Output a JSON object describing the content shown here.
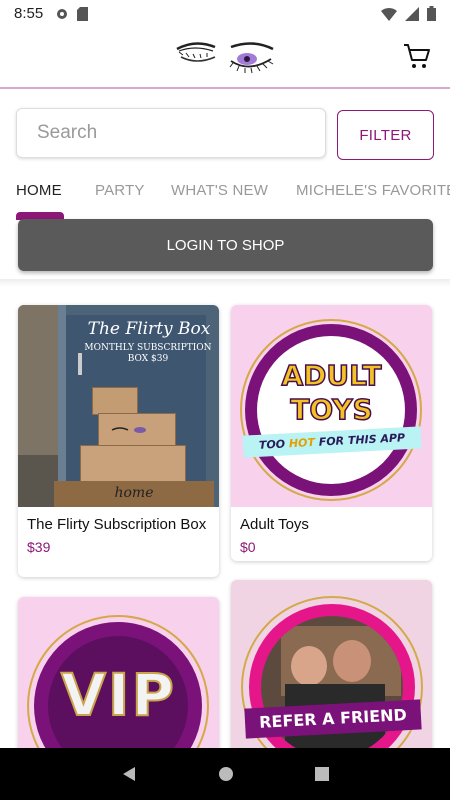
{
  "status_bar": {
    "time": "8:55"
  },
  "header": {
    "logo_icon": "eyelashes-logo",
    "cart_icon": "cart-icon"
  },
  "search": {
    "placeholder": "Search",
    "filter_label": "FILTER"
  },
  "tabs": [
    {
      "label": "HOME",
      "active": true
    },
    {
      "label": "PARTY"
    },
    {
      "label": "WHAT'S NEW"
    },
    {
      "label": "MICHELE'S FAVORITES"
    }
  ],
  "login_label": "LOGIN TO SHOP",
  "products": [
    {
      "title": "The Flirty Subscription Box",
      "price": "$39",
      "img_script": "The Flirty Box",
      "img_sub": "MONTHLY SUBSCRIPTION BOX $39",
      "img_mat": "home"
    },
    {
      "title": "Adult Toys",
      "price": "$0",
      "img_line1": "ADULT",
      "img_line2": "TOYS",
      "img_banner_a": "TOO ",
      "img_banner_b": "HOT",
      "img_banner_c": " FOR THIS APP"
    },
    {
      "img_text": "VIP"
    },
    {
      "img_banner": "REFER A FRIEND"
    }
  ],
  "colors": {
    "accent": "#8d1877",
    "pink_bg": "#f8d1ec",
    "purple": "#7a1279",
    "gold": "#d4a94a"
  }
}
